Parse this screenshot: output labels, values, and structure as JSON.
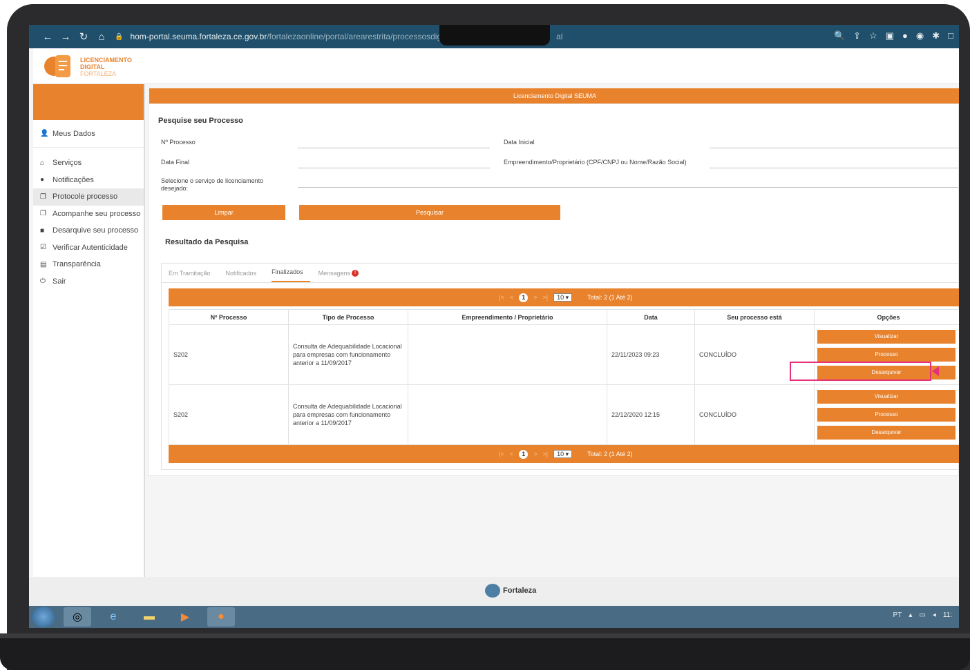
{
  "browser": {
    "url_host": "hom-portal.seuma.fortaleza.ce.gov.br",
    "url_path": "/fortalezaonline/portal/arearestrita/processosdigit",
    "url_tail": "al"
  },
  "logo": {
    "line1": "LICENCIAMENTO",
    "line2": "DIGITAL",
    "line3": "FORTALEZA"
  },
  "sidebar": {
    "user": "Meus Dados",
    "items": [
      {
        "label": "Serviços",
        "icon": "home-icon"
      },
      {
        "label": "Notificações",
        "icon": "alert-circle-icon"
      },
      {
        "label": "Protocole processo",
        "icon": "copy-icon"
      },
      {
        "label": "Acompanhe seu processo",
        "icon": "copy-icon"
      },
      {
        "label": "Desarquive seu processo",
        "icon": "archive-icon"
      },
      {
        "label": "Verificar Autenticidade",
        "icon": "check-square-icon"
      },
      {
        "label": "Transparência",
        "icon": "file-icon"
      },
      {
        "label": "Sair",
        "icon": "power-icon"
      }
    ]
  },
  "panel": {
    "title": "Licenciamento Digital SEUMA",
    "search_heading": "Pesquise seu Processo",
    "fields": {
      "processo": "Nº Processo",
      "data_inicial": "Data Inicial",
      "data_final": "Data Final",
      "empreendimento": "Empreendimento/Proprietário (CPF/CNPJ ou Nome/Razão Social)",
      "servico": "Selecione o serviço de licenciamento desejado:"
    },
    "limpar": "Limpar",
    "pesquisar": "Pesquisar",
    "result_heading": "Resultado da Pesquisa"
  },
  "tabs": [
    "Em Tramitação",
    "Notificados",
    "Finalizados",
    "Mensagens"
  ],
  "messages_badge": "!",
  "pager": {
    "page": "1",
    "per_page": "10",
    "total": "Total: 2 (1 Até 2)",
    "first": "|<",
    "prev": "<",
    "next": ">",
    "last": ">|"
  },
  "table": {
    "headers": [
      "Nº Processo",
      "Tipo de Processo",
      "Empreendimento / Proprietário",
      "Data",
      "Seu processo está",
      "Opções"
    ],
    "rows": [
      {
        "processo": "S202",
        "tipo": "Consulta de Adequabilidade Locacional para empresas com funcionamento anterior a 11/09/2017",
        "empreendimento": "",
        "data": "22/11/2023 09:23",
        "status": "CONCLUÍDO"
      },
      {
        "processo": "S202",
        "tipo": "Consulta de Adequabilidade Locacional para empresas com funcionamento anterior a 11/09/2017",
        "empreendimento": "",
        "data": "22/12/2020 12:15",
        "status": "CONCLUÍDO"
      }
    ],
    "options": {
      "visualizar": "Visualizar",
      "processo": "Processo",
      "desarquivar": "Desarquivar"
    }
  },
  "footer": {
    "brand": "Fortaleza"
  },
  "tray": {
    "lang": "PT",
    "time": "11:"
  },
  "colors": {
    "accent": "#e8822c",
    "browser": "#1f4f6a",
    "highlight": "#e6307a"
  }
}
